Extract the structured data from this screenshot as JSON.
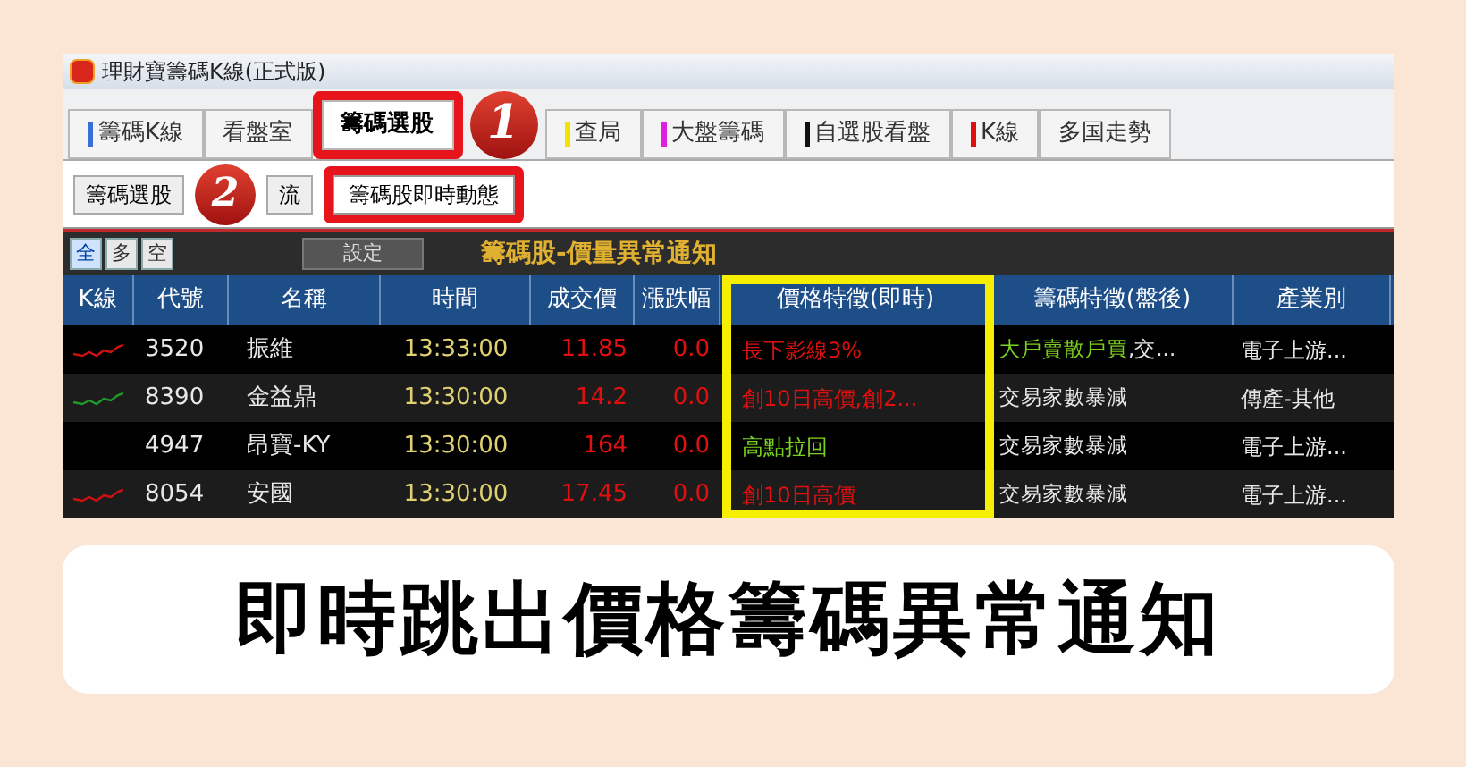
{
  "window": {
    "title": "理財寶籌碼K線(正式版)"
  },
  "tabs": [
    {
      "label": "籌碼K線",
      "color": "#3b6fd8",
      "selected": false
    },
    {
      "label": "看盤室",
      "selected": false
    },
    {
      "label": "籌碼選股",
      "selected": true
    },
    {
      "label": "查局",
      "color": "#f2e200",
      "selected": false
    },
    {
      "label": "大盤籌碼",
      "color": "#e020e0",
      "selected": false
    },
    {
      "label": "自選股看盤",
      "color": "#111111",
      "selected": false
    },
    {
      "label": "K線",
      "color": "#e01010",
      "selected": false
    },
    {
      "label": "多国走勢",
      "selected": false
    }
  ],
  "toolbar": {
    "buttons": [
      "籌碼選股",
      "流"
    ]
  },
  "menu": {
    "items": [
      "籌碼股即時動態"
    ]
  },
  "filters": [
    {
      "label": "全",
      "selected": true
    },
    {
      "label": "多",
      "selected": false
    },
    {
      "label": "空",
      "selected": false
    }
  ],
  "settings_button": "設定",
  "panel_title": "籌碼股-價量異常通知",
  "table": {
    "columns": [
      "K線",
      "代號",
      "名稱",
      "時間",
      "成交價",
      "漲跌幅",
      "價格特徵(即時)",
      "籌碼特徵(盤後)",
      "產業別"
    ],
    "rows": [
      {
        "color": "#d01010",
        "code": "3520",
        "name": "振維",
        "time": "13:33:00",
        "price": "11.85",
        "change": "0.0",
        "price_feature": {
          "text": "長下影線3%",
          "color": "#e01010"
        },
        "chip_feature": [
          {
            "text": "大戶賣散戶買",
            "color": "#7ad020"
          },
          {
            "text": ",交...",
            "color": "#e8e8e8"
          }
        ],
        "industry": "電子上游..."
      },
      {
        "color": "#1f9a2a",
        "code": "8390",
        "name": "金益鼎",
        "time": "13:30:00",
        "price": "14.2",
        "change": "0.0",
        "price_feature": {
          "text": "創10日高價,創2...",
          "color": "#e01010"
        },
        "chip_feature": [
          {
            "text": "交易家數暴減",
            "color": "#e8e8e8"
          }
        ],
        "industry": "傳產-其他"
      },
      {
        "code": "4947",
        "name": "昂寶-KY",
        "time": "13:30:00",
        "price": "164",
        "change": "0.0",
        "price_feature": {
          "text": "高點拉回",
          "color": "#7ad020"
        },
        "chip_feature": [
          {
            "text": "交易家數暴減",
            "color": "#e8e8e8"
          }
        ],
        "industry": "電子上游..."
      },
      {
        "color": "#d01010",
        "code": "8054",
        "name": "安國",
        "time": "13:30:00",
        "price": "17.45",
        "change": "0.0",
        "price_feature": {
          "text": "創10日高價",
          "color": "#e01010"
        },
        "chip_feature": [
          {
            "text": "交易家數暴減",
            "color": "#e8e8e8"
          }
        ],
        "industry": "電子上游..."
      }
    ]
  },
  "annotations": [
    {
      "label": "1"
    },
    {
      "label": "2"
    }
  ],
  "caption": "即時跳出價格籌碼異常通知"
}
